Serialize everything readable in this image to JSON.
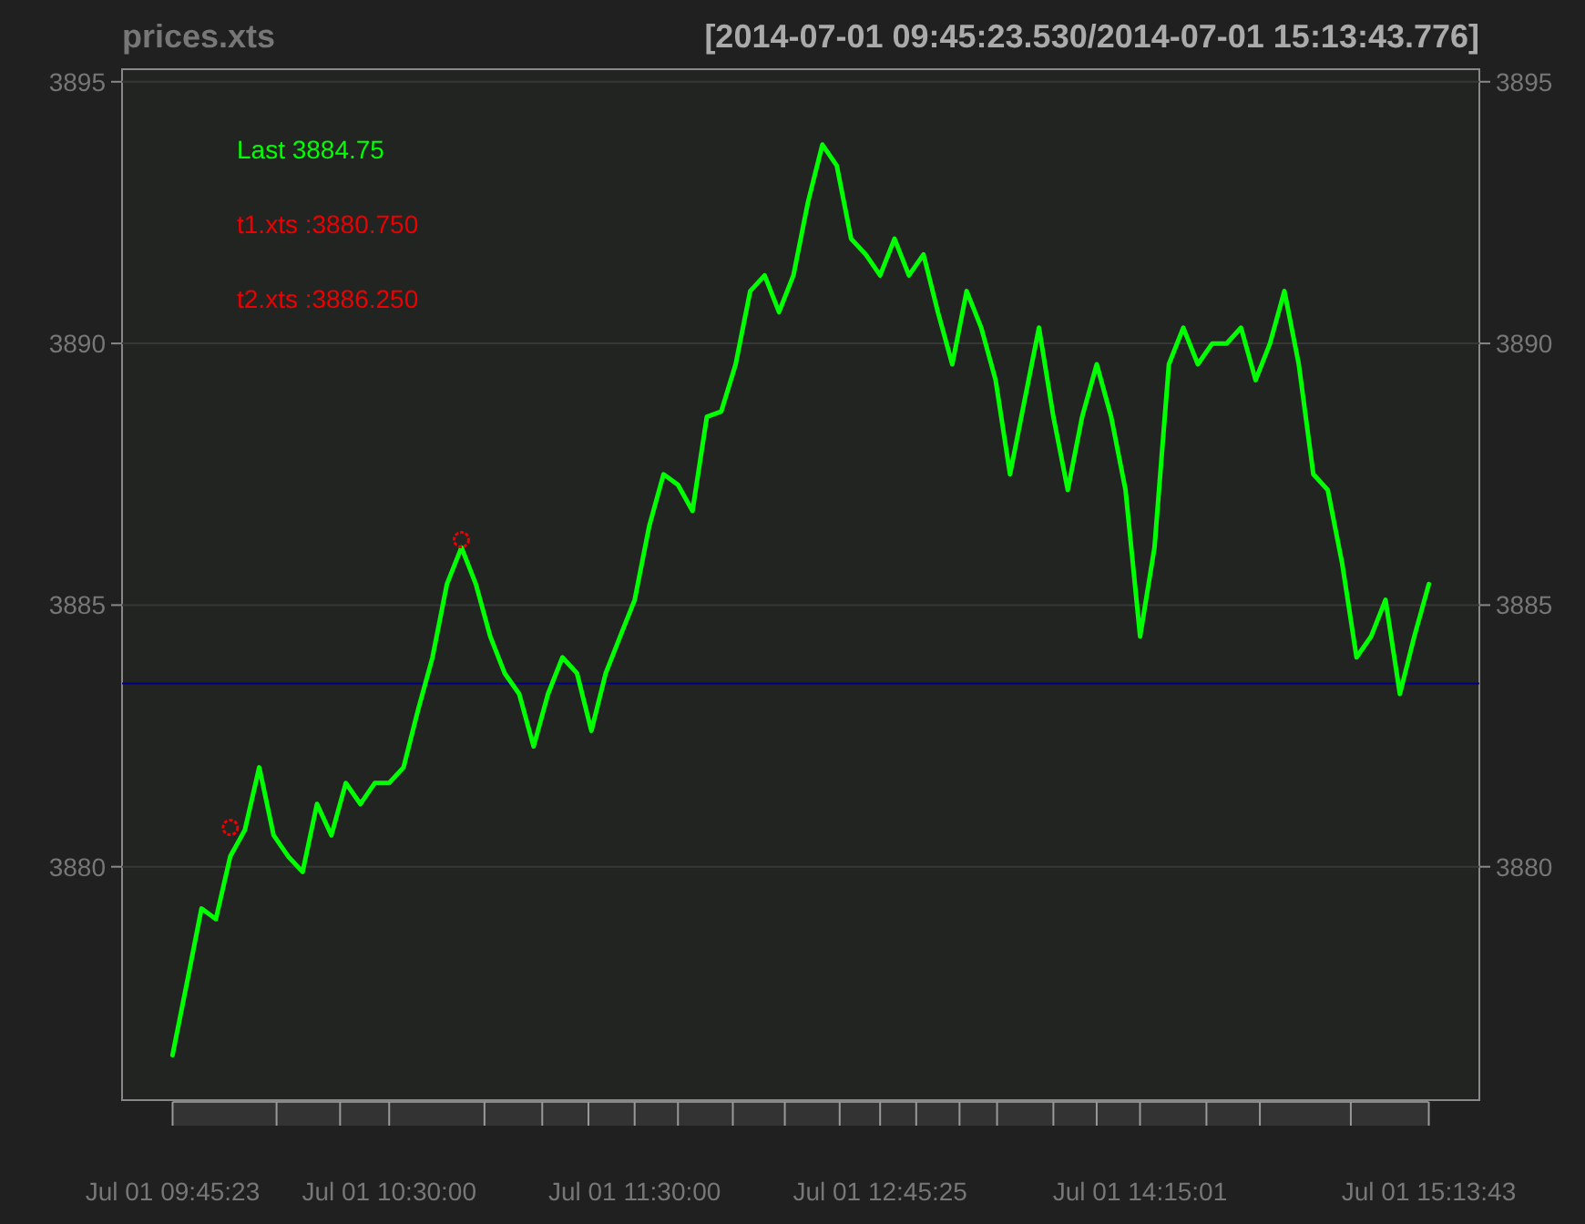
{
  "title": "prices.xts",
  "date_range": "[2014-07-01 09:45:23.530/2014-07-01 15:13:43.776]",
  "legend": [
    {
      "value_text": "3884.75"
    },
    {
      "value_text": ":3880.750"
    },
    {
      "value_text": ":3886.250"
    }
  ],
  "chart_data": {
    "type": "line",
    "grid": true,
    "ylim": [
      3875.54,
      3895.24
    ],
    "yticks": [
      3880,
      3885,
      3890,
      3895
    ],
    "y2lim": [
      3875.54,
      3895.24
    ],
    "y2ticks": [
      3880,
      3885,
      3890,
      3895
    ],
    "categories": [
      "Jul 01 09:45:23",
      null,
      null,
      null,
      null,
      null,
      null,
      null,
      null,
      null,
      null,
      null,
      null,
      null,
      null,
      "Jul 01 10:30:00",
      null,
      null,
      null,
      null,
      null,
      null,
      null,
      null,
      null,
      null,
      null,
      null,
      null,
      null,
      null,
      null,
      "Jul 01 11:30:00",
      null,
      null,
      null,
      null,
      null,
      null,
      null,
      null,
      null,
      null,
      null,
      null,
      null,
      null,
      null,
      null,
      "Jul 01 12:45:25",
      null,
      null,
      null,
      null,
      null,
      null,
      null,
      null,
      null,
      null,
      null,
      null,
      null,
      null,
      null,
      null,
      null,
      "Jul 01 14:15:01",
      null,
      null,
      null,
      null,
      null,
      null,
      null,
      null,
      null,
      null,
      null,
      null,
      null,
      null,
      null,
      null,
      null,
      null,
      null,
      "Jul 01 15:13:43"
    ],
    "series": [
      {
        "name": "Last",
        "color": "#00ff00",
        "values": [
          3876.4,
          3877.8,
          3879.2,
          3879.0,
          3880.2,
          3880.7,
          3881.9,
          3880.6,
          3880.2,
          3879.9,
          3881.2,
          3880.6,
          3881.6,
          3881.2,
          3881.6,
          3881.6,
          3881.9,
          3883.0,
          3884.0,
          3885.4,
          3886.1,
          3885.4,
          3884.4,
          3883.7,
          3883.3,
          3882.3,
          3883.3,
          3884.0,
          3883.7,
          3882.6,
          3883.7,
          3884.4,
          3885.1,
          3886.5,
          3887.5,
          3887.3,
          3886.8,
          3888.6,
          3888.7,
          3889.6,
          3891.0,
          3891.3,
          3890.6,
          3891.3,
          3892.7,
          3893.8,
          3893.4,
          3892.0,
          3891.7,
          3891.3,
          3892.0,
          3891.3,
          3891.7,
          3890.6,
          3889.6,
          3891.0,
          3890.3,
          3889.3,
          3887.5,
          3888.9,
          3890.3,
          3888.6,
          3887.2,
          3888.6,
          3889.6,
          3888.6,
          3887.2,
          3884.4,
          3886.1,
          3889.6,
          3890.3,
          3889.6,
          3890.0,
          3890.0,
          3890.3,
          3889.3,
          3890.0,
          3891.0,
          3889.6,
          3887.5,
          3887.2,
          3885.8,
          3884.0,
          3884.4,
          3885.1,
          3883.3,
          3884.4,
          3885.4
        ]
      },
      {
        "name": "t1.xts",
        "color": "#ee0000",
        "marker": "circle",
        "values": [
          null,
          null,
          null,
          null,
          3880.75,
          null,
          null,
          null,
          null,
          null,
          null,
          null,
          null,
          null,
          null,
          null,
          null,
          null,
          null,
          null,
          null,
          null,
          null,
          null,
          null,
          null,
          null,
          null,
          null,
          null,
          null,
          null,
          null,
          null,
          null,
          null,
          null,
          null,
          null,
          null,
          null,
          null,
          null,
          null,
          null,
          null,
          null,
          null,
          null,
          null,
          null,
          null,
          null,
          null,
          null,
          null,
          null,
          null,
          null,
          null,
          null,
          null,
          null,
          null,
          null,
          null,
          null,
          null,
          null,
          null,
          null,
          null,
          null,
          null,
          null,
          null,
          null,
          null,
          null,
          null,
          null,
          null,
          null,
          null,
          null,
          null,
          null,
          null
        ]
      },
      {
        "name": "t2.xts",
        "color": "#ee0000",
        "marker": "circle",
        "values": [
          null,
          null,
          null,
          null,
          null,
          null,
          null,
          null,
          null,
          null,
          null,
          null,
          null,
          null,
          null,
          null,
          null,
          null,
          null,
          null,
          3886.25,
          null,
          null,
          null,
          null,
          null,
          null,
          null,
          null,
          null,
          null,
          null,
          null,
          null,
          null,
          null,
          null,
          null,
          null,
          null,
          null,
          null,
          null,
          null,
          null,
          null,
          null,
          null,
          null,
          null,
          null,
          null,
          null,
          null,
          null,
          null,
          null,
          null,
          null,
          null,
          null,
          null,
          null,
          null,
          null,
          null,
          null,
          null,
          null,
          null,
          null,
          null,
          null,
          null,
          null,
          null,
          null,
          null,
          null,
          null,
          null,
          null,
          null,
          null,
          null,
          null,
          null,
          null
        ]
      }
    ],
    "ref_lines": [
      {
        "axis": "y",
        "value": 3883.5
      }
    ]
  }
}
